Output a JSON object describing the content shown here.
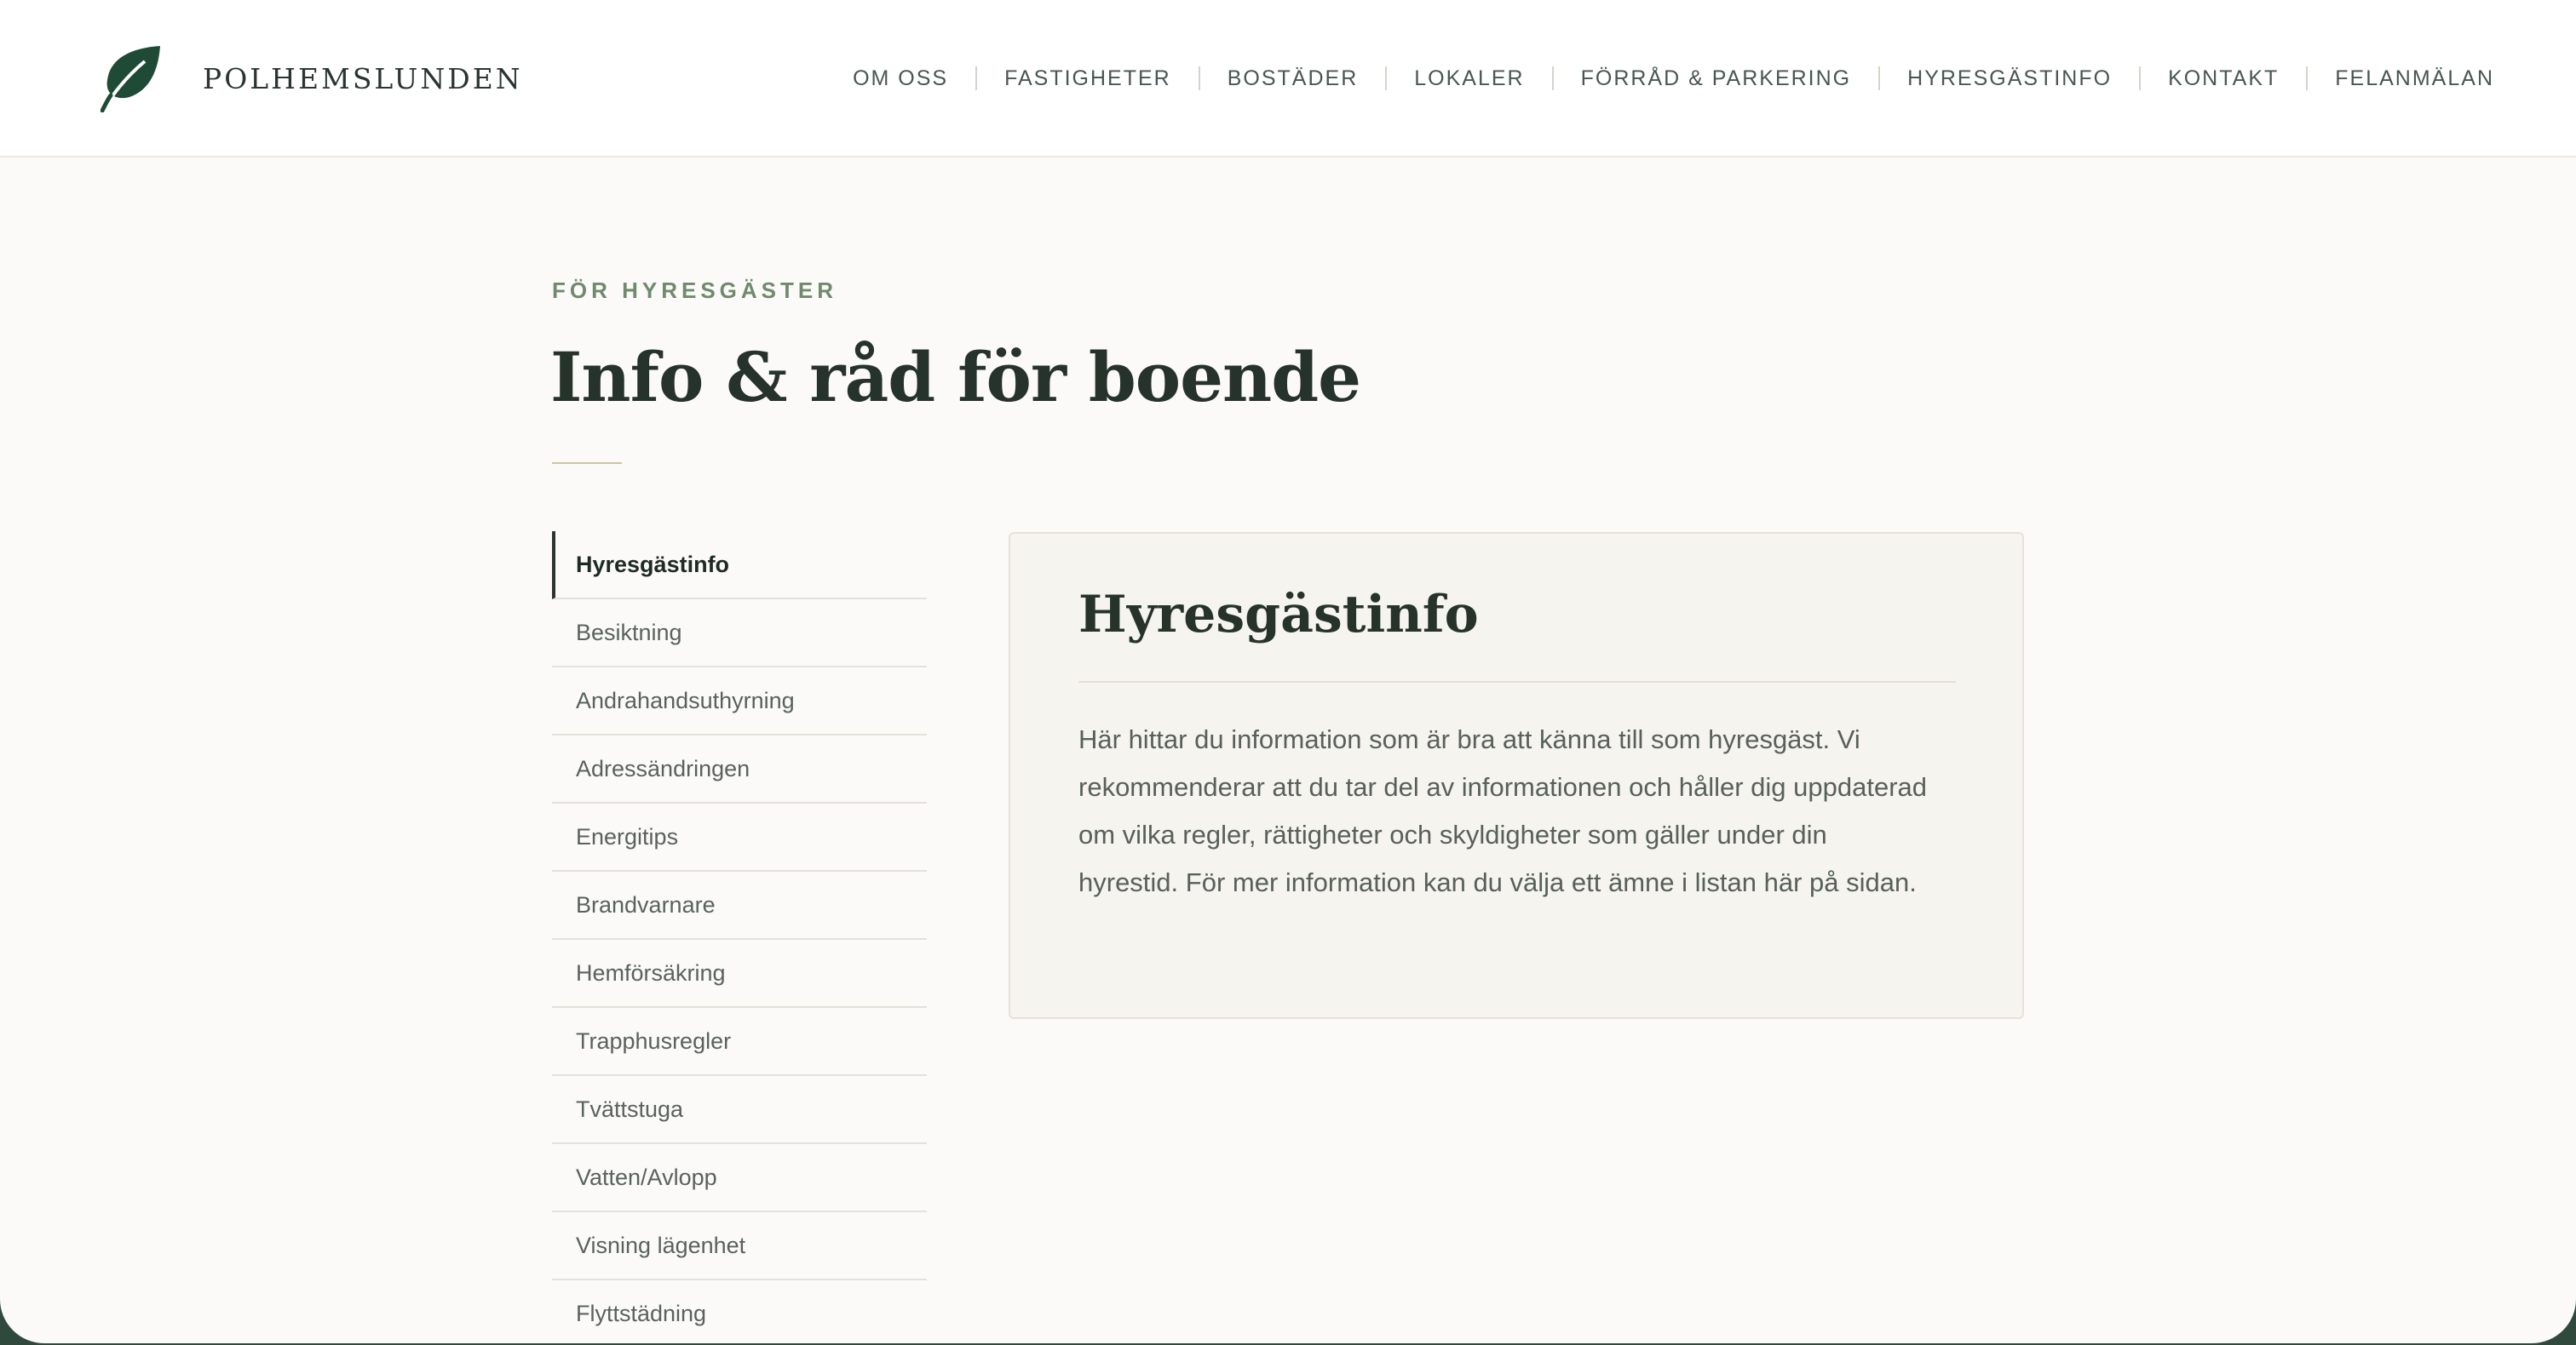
{
  "brand": {
    "name": "POLHEMSLUNDEN",
    "logo_icon": "leaf-icon"
  },
  "nav": {
    "items": [
      {
        "label": "OM OSS"
      },
      {
        "label": "FASTIGHETER"
      },
      {
        "label": "BOSTÄDER"
      },
      {
        "label": "LOKALER"
      },
      {
        "label": "FÖRRÅD & PARKERING"
      },
      {
        "label": "HYRESGÄSTINFO"
      },
      {
        "label": "KONTAKT"
      },
      {
        "label": "FELANMÄLAN"
      }
    ]
  },
  "page": {
    "eyebrow": "FÖR HYRESGÄSTER",
    "title": "Info & råd för boende"
  },
  "sidebar": {
    "items": [
      {
        "label": "Hyresgästinfo",
        "active": true
      },
      {
        "label": "Besiktning"
      },
      {
        "label": "Andrahandsuthyrning"
      },
      {
        "label": "Adressändringen"
      },
      {
        "label": "Energitips"
      },
      {
        "label": "Brandvarnare"
      },
      {
        "label": "Hemförsäkring"
      },
      {
        "label": "Trapphusregler"
      },
      {
        "label": "Tvättstuga"
      },
      {
        "label": "Vatten/Avlopp"
      },
      {
        "label": "Visning lägenhet"
      },
      {
        "label": "Flyttstädning"
      }
    ]
  },
  "content": {
    "title": "Hyresgästinfo",
    "body_lines": [
      "Här hittar du information som är bra att känna till som hyresgäst. Vi",
      "rekommenderar att du tar del av informationen och håller dig uppdaterad",
      "om vilka regler, rättigheter och skyldigheter som gäller under din",
      "hyrestid. För mer information kan du välja ett ämne i listan här på sidan."
    ]
  },
  "colors": {
    "accent_green": "#1f4a36",
    "eyebrow_green": "#6f8a6c",
    "heading": "#26332b",
    "background": "#fbfaf8",
    "card_bg": "#f6f4ef"
  }
}
